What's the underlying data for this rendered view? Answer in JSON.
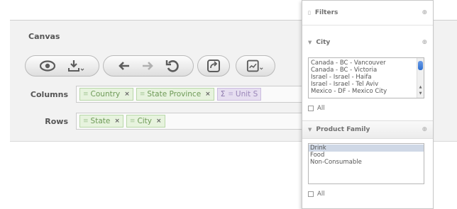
{
  "canvas": {
    "title": "Canvas",
    "toolbar": {
      "groups": [
        {
          "buttons": [
            {
              "icon": "eye-icon"
            },
            {
              "icon": "download-icon"
            }
          ]
        },
        {
          "buttons": [
            {
              "icon": "undo-icon"
            },
            {
              "icon": "redo-icon"
            },
            {
              "icon": "refresh-icon"
            }
          ]
        },
        {
          "buttons": [
            {
              "icon": "swap-axes-icon"
            }
          ]
        },
        {
          "buttons": [
            {
              "icon": "chart-options-icon"
            }
          ]
        }
      ]
    },
    "columns": {
      "label": "Columns",
      "pills": [
        {
          "text": "Country"
        },
        {
          "text": "State Province"
        },
        {
          "text": "Unit S"
        }
      ]
    },
    "rows": {
      "label": "Rows",
      "pills": [
        {
          "text": "State"
        },
        {
          "text": "City"
        }
      ]
    }
  },
  "filters": {
    "title": "Filters",
    "city": {
      "title": "City",
      "options": [
        "Canada - BC - Vancouver",
        "Canada - BC - Victoria",
        "Israel - Israel - Haifa",
        "Israel - Israel - Tel Aviv",
        "Mexico - DF - Mexico City"
      ],
      "all_label": "All"
    },
    "product_family": {
      "title": "Product Family",
      "options": [
        "Drink",
        "Food",
        "Non-Consumable"
      ],
      "selected_index": 0,
      "all_label": "All"
    }
  }
}
